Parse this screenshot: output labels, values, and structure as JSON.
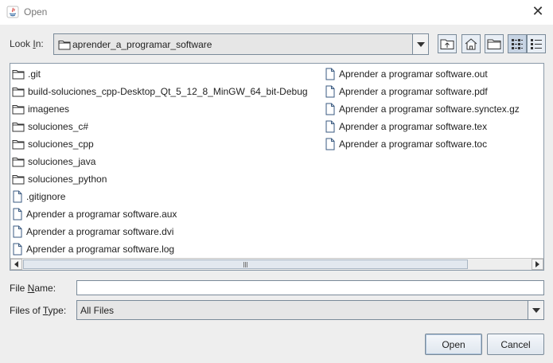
{
  "window": {
    "title": "Open",
    "close_glyph": "✕"
  },
  "lookin": {
    "label_pre": "Look ",
    "label_mnemonic": "I",
    "label_post": "n:",
    "value": "aprender_a_programar_software"
  },
  "toolbar": {
    "icons": [
      "up-one-level-icon",
      "home-icon",
      "new-folder-icon",
      "list-view-icon",
      "details-view-icon"
    ]
  },
  "files": {
    "column1": [
      {
        "name": ".git",
        "type": "folder"
      },
      {
        "name": "build-soluciones_cpp-Desktop_Qt_5_12_8_MinGW_64_bit-Debug",
        "type": "folder"
      },
      {
        "name": "imagenes",
        "type": "folder"
      },
      {
        "name": "soluciones_c#",
        "type": "folder"
      },
      {
        "name": "soluciones_cpp",
        "type": "folder"
      },
      {
        "name": "soluciones_java",
        "type": "folder"
      },
      {
        "name": "soluciones_python",
        "type": "folder"
      },
      {
        "name": ".gitignore",
        "type": "file"
      },
      {
        "name": "Aprender a programar software.aux",
        "type": "file"
      },
      {
        "name": "Aprender a programar software.dvi",
        "type": "file"
      },
      {
        "name": "Aprender a programar software.log",
        "type": "file"
      }
    ],
    "column2": [
      {
        "name": "Aprender a programar software.out",
        "type": "file"
      },
      {
        "name": "Aprender a programar software.pdf",
        "type": "file"
      },
      {
        "name": "Aprender a programar software.synctex.gz",
        "type": "file"
      },
      {
        "name": "Aprender a programar software.tex",
        "type": "file"
      },
      {
        "name": "Aprender a programar software.toc",
        "type": "file"
      }
    ]
  },
  "filename": {
    "label_pre": "File ",
    "label_mnemonic": "N",
    "label_post": "ame:",
    "value": ""
  },
  "filetype": {
    "label_pre": "Files of ",
    "label_mnemonic": "T",
    "label_post": "ype:",
    "value": "All Files"
  },
  "buttons": {
    "open": "Open",
    "cancel": "Cancel"
  },
  "colors": {
    "background": "#eeeeee",
    "list_bg": "#ffffff",
    "border": "#7a8a99",
    "selected_toggle": "#c7d4e4"
  }
}
